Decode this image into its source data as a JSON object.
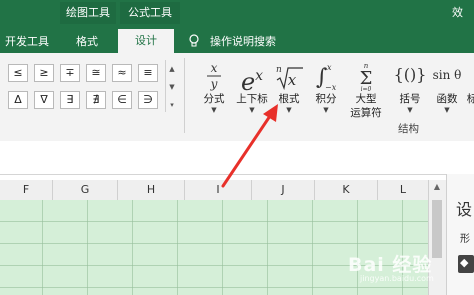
{
  "title_bar": {
    "corner_text": "效"
  },
  "context_tabs": [
    {
      "label": "绘图工具"
    },
    {
      "label": "公式工具"
    }
  ],
  "tabs": [
    {
      "label": "开发工具"
    },
    {
      "label": "格式"
    },
    {
      "label": "设计",
      "selected": true
    }
  ],
  "help": {
    "label": "操作说明搜索",
    "icon": "lightbulb-icon"
  },
  "symbols": {
    "row1": [
      "≤",
      "≥",
      "∓",
      "≅",
      "≈",
      "≡"
    ],
    "row2": [
      "Δ",
      "∇",
      "∃",
      "∄",
      "∈",
      "∋"
    ]
  },
  "structures": {
    "group_label": "结构",
    "tools": [
      {
        "icon_text": "x/y",
        "label": "分式"
      },
      {
        "icon_text": "eˣ",
        "label": "上下标"
      },
      {
        "icon_text": "ⁿ√x",
        "label": "根式"
      },
      {
        "icon_text": "∫",
        "label": "积分"
      },
      {
        "icon_text": "Σ",
        "label": "大型",
        "label2": "运算符"
      },
      {
        "icon_text": "{()}",
        "label": "括号"
      },
      {
        "icon_text": "sinθ",
        "label": "函数"
      },
      {
        "icon_text": "",
        "label": "标"
      }
    ]
  },
  "columns": [
    "F",
    "G",
    "H",
    "I",
    "J",
    "K",
    "L"
  ],
  "side_pane": {
    "title": "设",
    "subtitle": "形"
  },
  "watermark": {
    "text": "Bai 经验",
    "sub": "jingyan.baidu.com"
  },
  "colors": {
    "excel_green": "#217346",
    "annotation_arrow": "#e8302a",
    "grid_fill": "#d5efd8"
  }
}
